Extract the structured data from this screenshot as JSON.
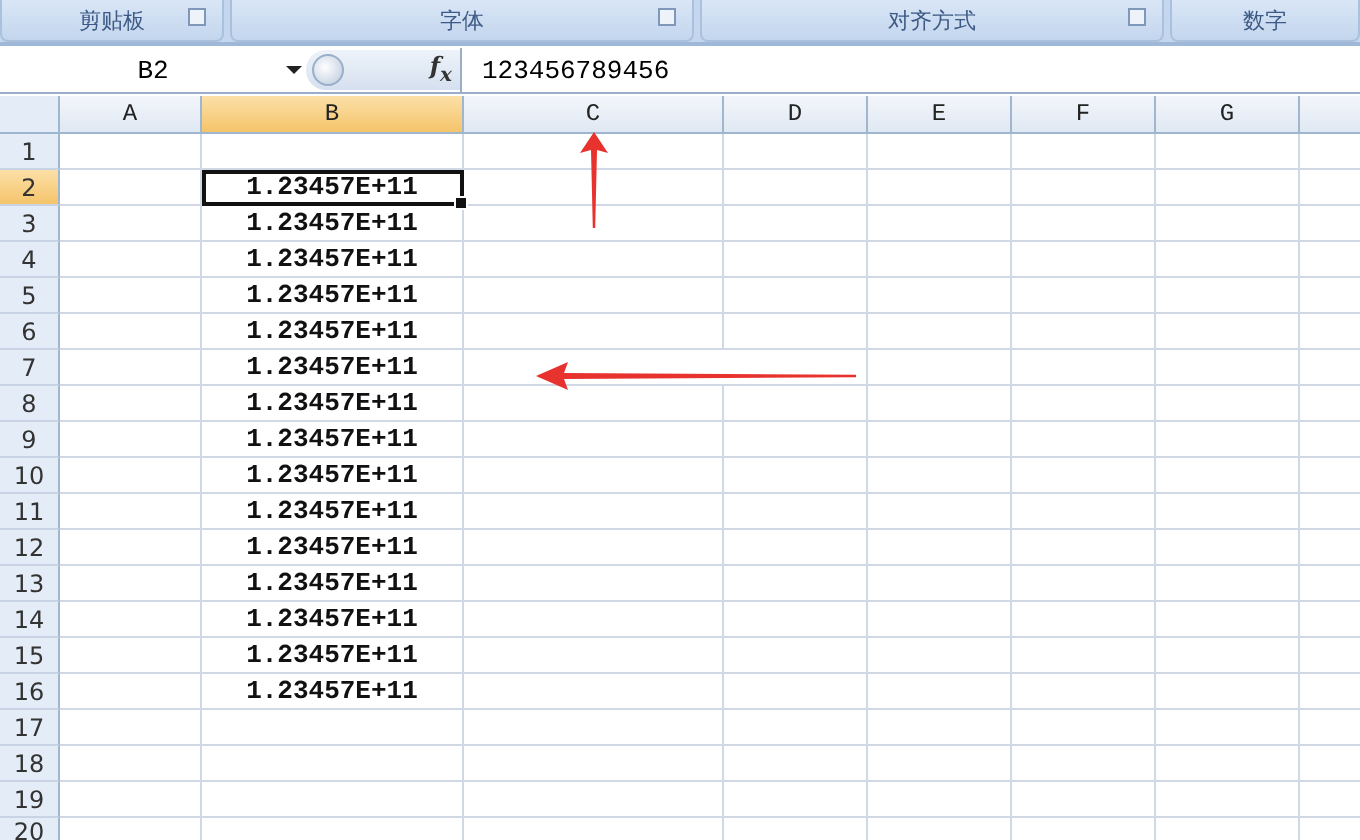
{
  "ribbon_groups": [
    {
      "label": "剪贴板",
      "launcher": true
    },
    {
      "label": "字体",
      "launcher": true
    },
    {
      "label": "对齐方式",
      "launcher": true
    },
    {
      "label": "数字",
      "launcher": false
    }
  ],
  "formula_bar": {
    "name_box": "B2",
    "function_button": "f$_{x}$",
    "content": "123456789456"
  },
  "columns": [
    {
      "label": "A",
      "selected": false
    },
    {
      "label": "B",
      "selected": true
    },
    {
      "label": "C",
      "selected": false
    },
    {
      "label": "D",
      "selected": false
    },
    {
      "label": "E",
      "selected": false
    },
    {
      "label": "F",
      "selected": false
    },
    {
      "label": "G",
      "selected": false
    }
  ],
  "rows": [
    {
      "label": "1",
      "selected": false
    },
    {
      "label": "2",
      "selected": true,
      "column_b": "1.23457E+11"
    },
    {
      "label": "3",
      "selected": false,
      "column_b": "1.23457E+11"
    },
    {
      "label": "4",
      "selected": false,
      "column_b": "1.23457E+11"
    },
    {
      "label": "5",
      "selected": false,
      "column_b": "1.23457E+11"
    },
    {
      "label": "6",
      "selected": false,
      "column_b": "1.23457E+11"
    },
    {
      "label": "7",
      "selected": false,
      "column_b": "1.23457E+11"
    },
    {
      "label": "8",
      "selected": false,
      "column_b": "1.23457E+11"
    },
    {
      "label": "9",
      "selected": false,
      "column_b": "1.23457E+11"
    },
    {
      "label": "10",
      "selected": false,
      "column_b": "1.23457E+11"
    },
    {
      "label": "11",
      "selected": false,
      "column_b": "1.23457E+11"
    },
    {
      "label": "12",
      "selected": false,
      "column_b": "1.23457E+11"
    },
    {
      "label": "13",
      "selected": false,
      "column_b": "1.23457E+11"
    },
    {
      "label": "14",
      "selected": false,
      "column_b": "1.23457E+11"
    },
    {
      "label": "15",
      "selected": false,
      "column_b": "1.23457E+11"
    },
    {
      "label": "16",
      "selected": false,
      "column_b": "1.23457E+11"
    },
    {
      "label": "17",
      "selected": false
    },
    {
      "label": "18",
      "selected": false
    },
    {
      "label": "19",
      "selected": false
    },
    {
      "label": "20",
      "selected": false
    }
  ],
  "annotations": [
    {
      "kind": "arrow_up"
    },
    {
      "kind": "arrow_left"
    }
  ]
}
